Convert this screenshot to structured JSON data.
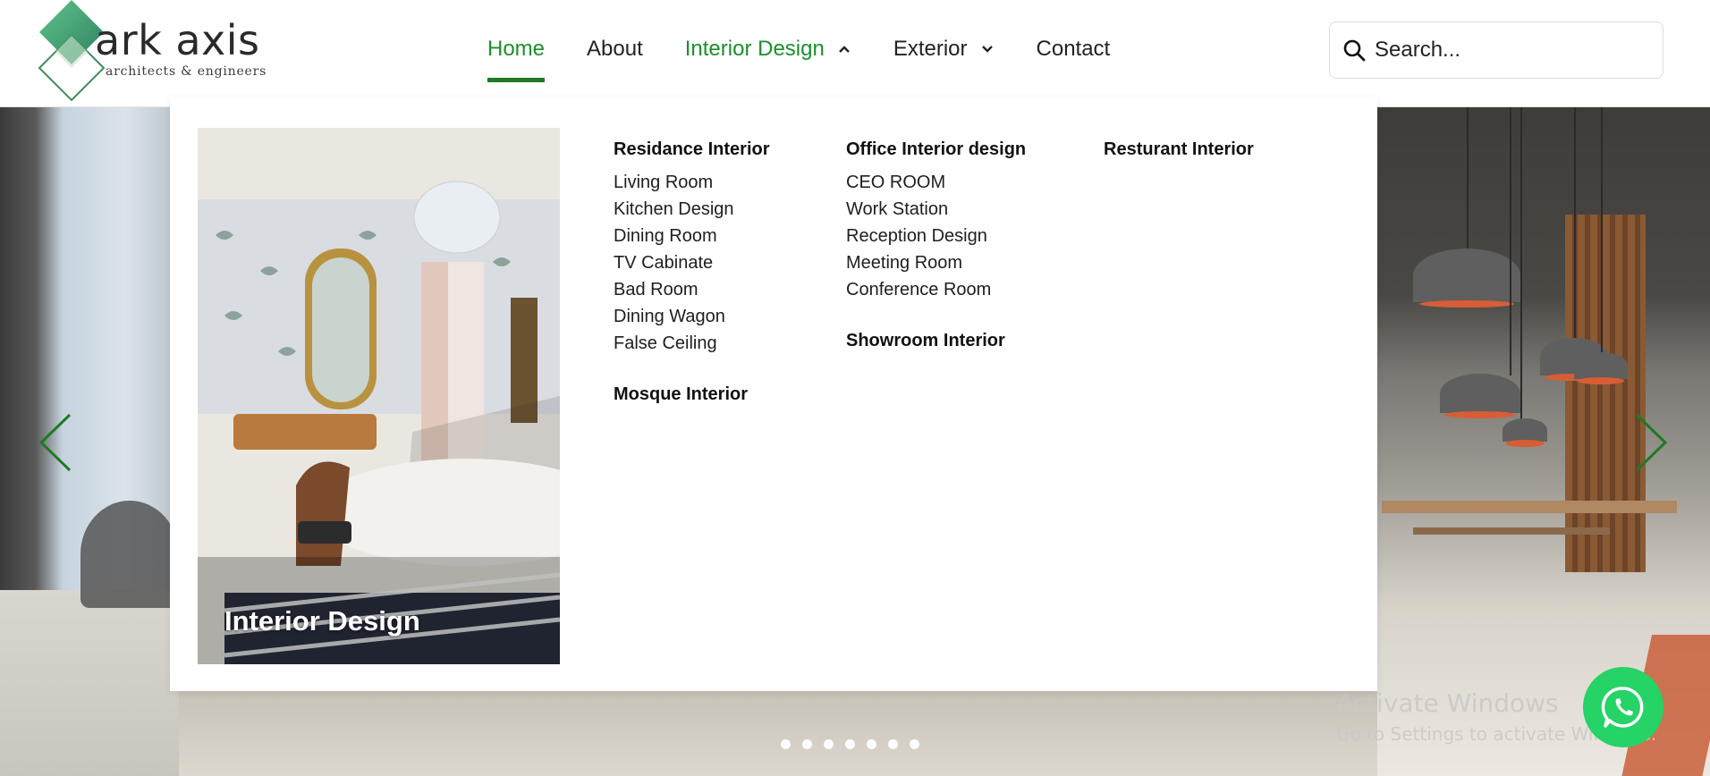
{
  "brand": {
    "name": "ark axis",
    "tagline": "architects & engineers",
    "colors": {
      "green": "#1a8f2b",
      "dark_green": "#1f7a23",
      "teal": "#3fa37a"
    }
  },
  "nav": {
    "items": [
      {
        "label": "Home",
        "state": "active"
      },
      {
        "label": "About",
        "state": "default"
      },
      {
        "label": "Interior Design",
        "state": "open",
        "caret": "chevron-up-icon"
      },
      {
        "label": "Exterior",
        "state": "default",
        "caret": "chevron-down-icon"
      },
      {
        "label": "Contact",
        "state": "default"
      }
    ]
  },
  "search": {
    "placeholder": "Search...",
    "icon": "search-icon"
  },
  "mega_menu": {
    "promo_title": "Interior Design",
    "columns": [
      {
        "sections": [
          {
            "heading": "Residance Interior",
            "links": [
              "Living Room",
              "Kitchen Design",
              "Dining Room",
              "TV Cabinate",
              "Bad Room",
              "Dining Wagon",
              "False Ceiling"
            ]
          },
          {
            "heading": "Mosque Interior",
            "links": []
          }
        ]
      },
      {
        "sections": [
          {
            "heading": "Office Interior design",
            "links": [
              "CEO ROOM",
              "Work Station",
              "Reception Design",
              "Meeting Room",
              "Conference Room"
            ]
          },
          {
            "heading": "Showroom Interior",
            "links": []
          }
        ]
      },
      {
        "sections": [
          {
            "heading": "Resturant Interior",
            "links": []
          }
        ]
      }
    ]
  },
  "carousel": {
    "slide_count": 7,
    "prev_icon": "chevron-left-icon",
    "next_icon": "chevron-right-icon"
  },
  "watermark": {
    "line1": "Activate Windows",
    "line2": "Go to Settings to activate Windows."
  },
  "whatsapp": {
    "icon": "whatsapp-icon"
  }
}
